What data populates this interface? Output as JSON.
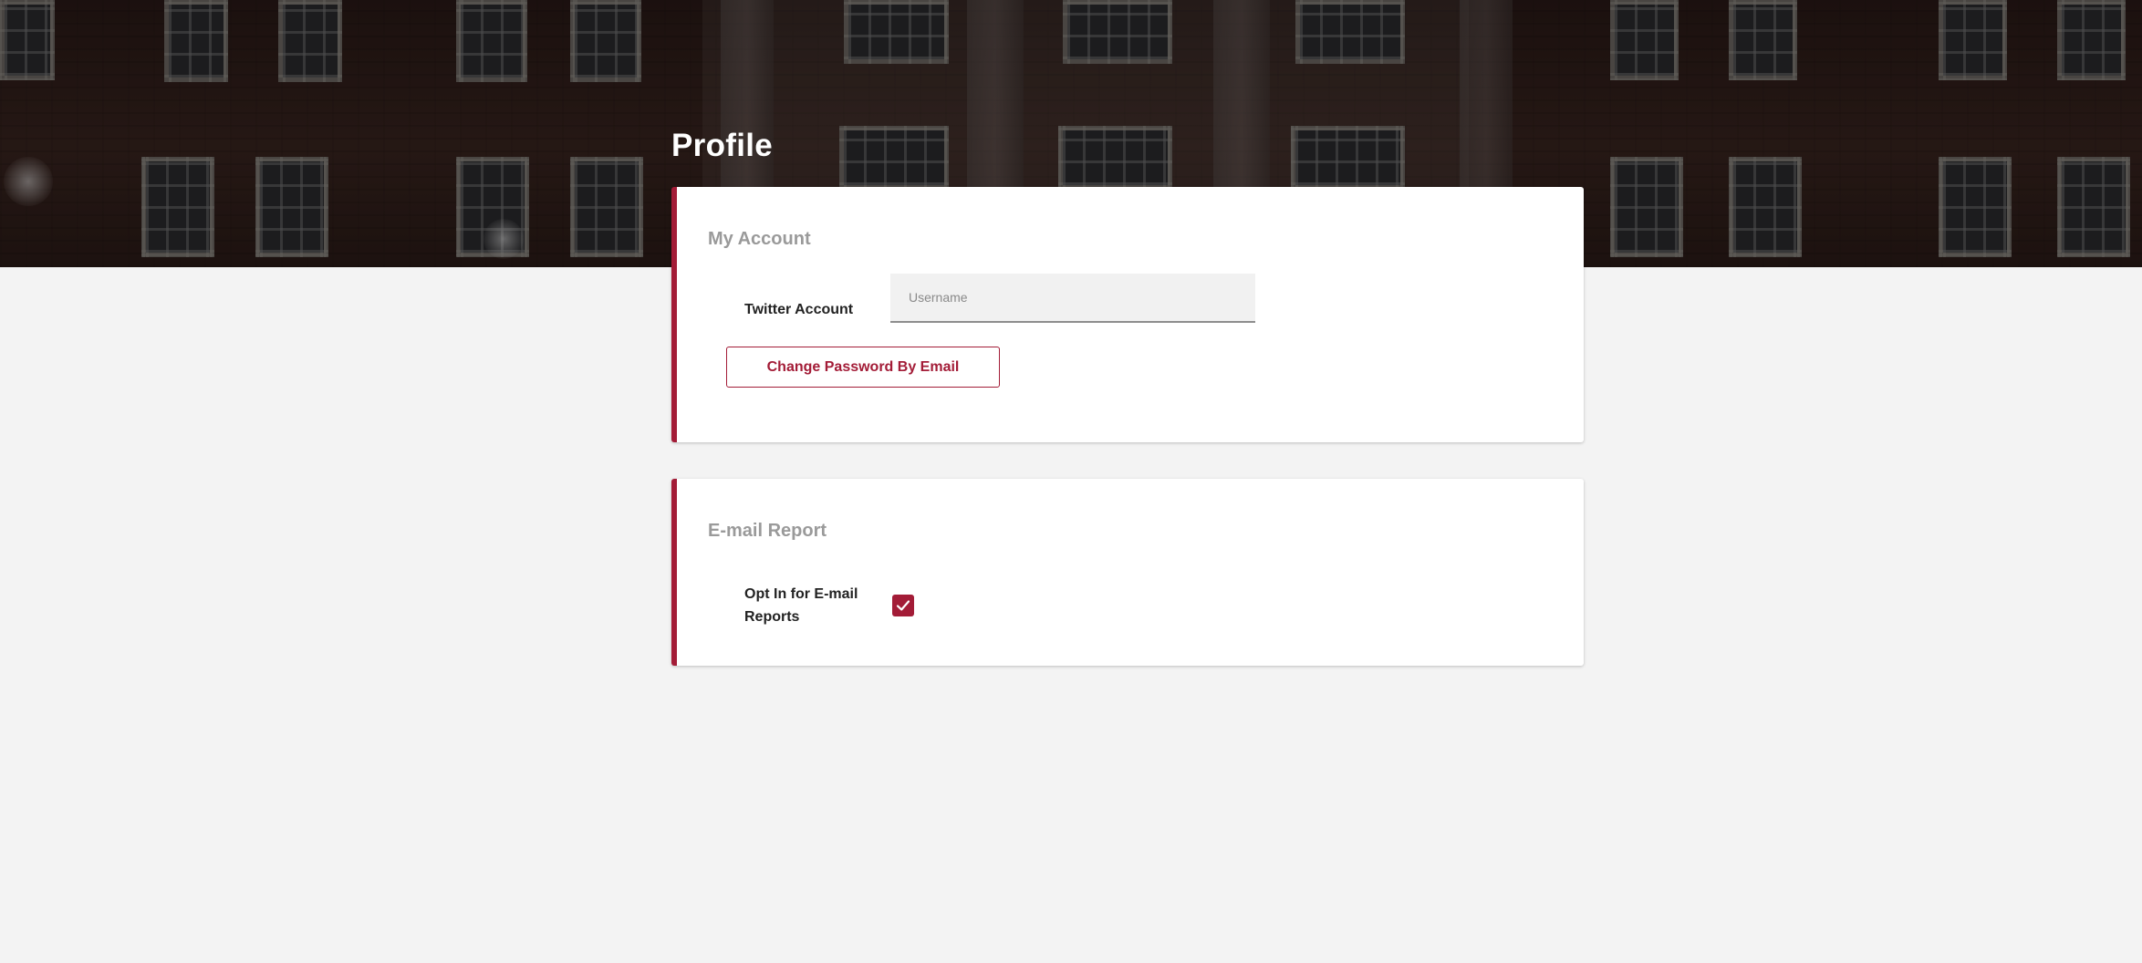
{
  "header": {
    "title": "Profile"
  },
  "my_account": {
    "title": "My Account",
    "twitter_label": "Twitter Account",
    "twitter_placeholder": "Username",
    "twitter_value": "",
    "change_password_label": "Change Password By Email"
  },
  "email_report": {
    "title": "E-mail Report",
    "opt_in_label": "Opt In for E-mail Reports",
    "opt_in_checked": true
  },
  "colors": {
    "accent": "#a31c37",
    "page_background": "#f3f3f3",
    "card_title": "#9a9a9a"
  },
  "icons": {
    "checkbox_mark": "check-icon"
  }
}
